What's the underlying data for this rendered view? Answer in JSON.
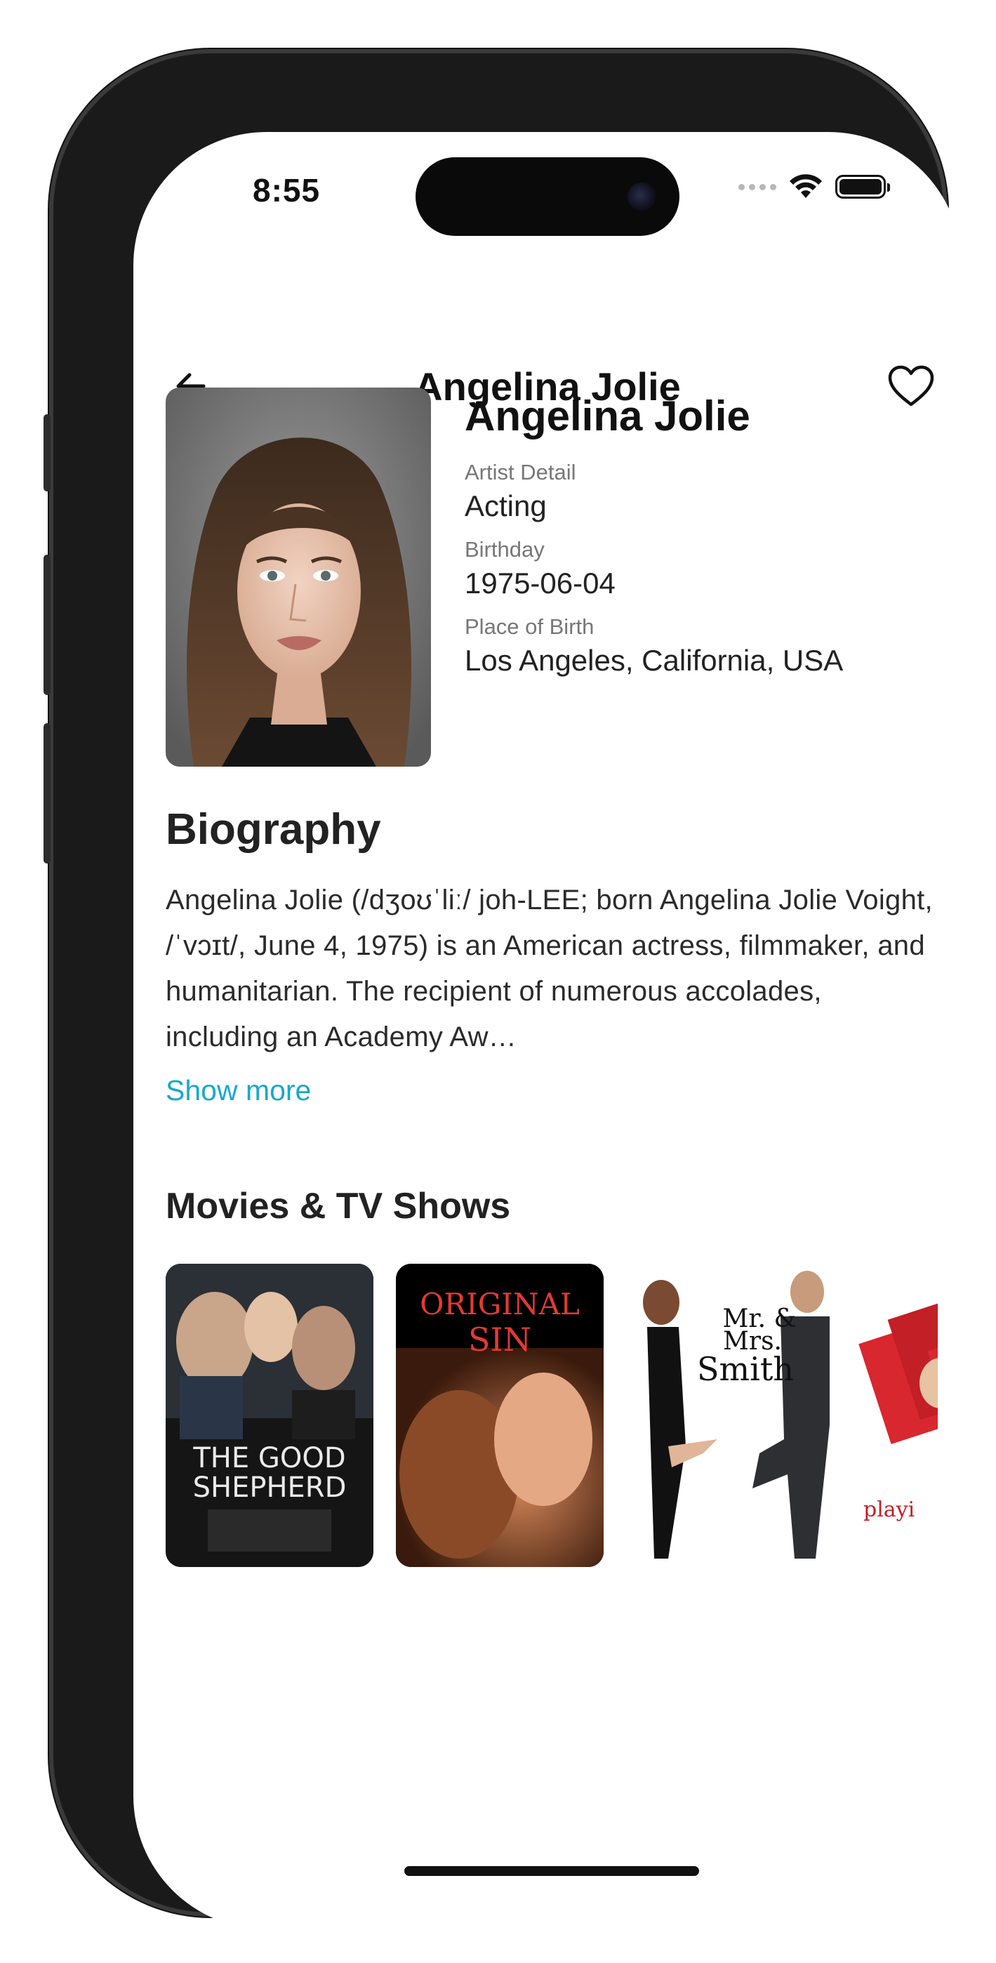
{
  "status": {
    "time": "8:55"
  },
  "nav": {
    "title": "Angelina Jolie"
  },
  "profile": {
    "name": "Angelina Jolie",
    "fields": [
      {
        "label": "Artist Detail",
        "value": "Acting"
      },
      {
        "label": "Birthday",
        "value": "1975-06-04"
      },
      {
        "label": "Place of Birth",
        "value": "Los Angeles, California, USA"
      }
    ]
  },
  "biography": {
    "heading": "Biography",
    "text": "Angelina Jolie (/dʒoʊˈliː/ joh-LEE; born Angelina Jolie Voight, /ˈvɔɪt/, June 4, 1975) is an American actress, filmmaker, and humanitarian. The recipient of numerous accolades, including an Academy Aw…",
    "show_more": "Show more"
  },
  "movies": {
    "heading": "Movies & TV Shows",
    "posters": [
      {
        "title_line1": "THE GOOD",
        "title_line2": "SHEPHERD"
      },
      {
        "title_line1": "ORIGINAL",
        "title_line2": "SIN"
      },
      {
        "title_line1": "Mr. &",
        "title_line2": "Mrs.",
        "title_line3": "Smith"
      },
      {
        "title_line1": "playi"
      }
    ]
  },
  "colors": {
    "accent": "#18a9c8",
    "text": "#222222",
    "muted": "#777777"
  }
}
